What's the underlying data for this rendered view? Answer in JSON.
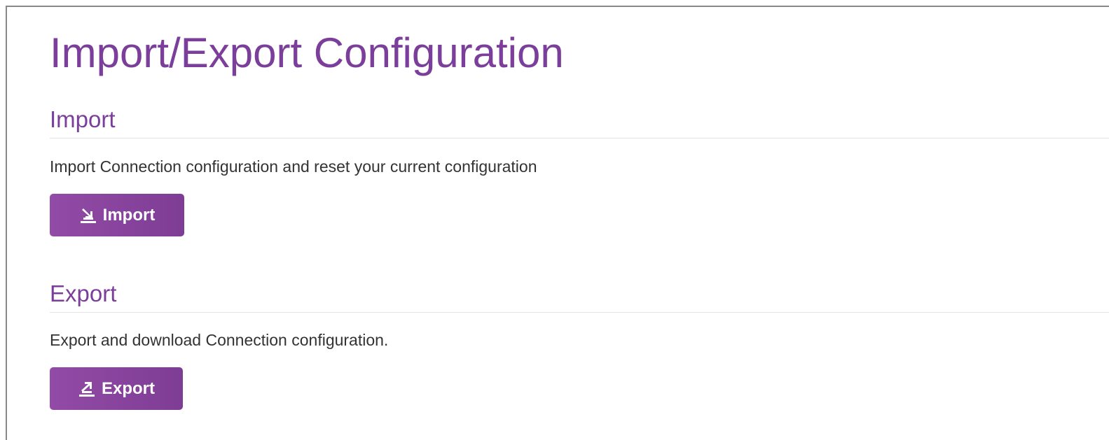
{
  "page": {
    "title": "Import/Export Configuration"
  },
  "import_section": {
    "heading": "Import",
    "description": "Import Connection configuration and reset your current configuration",
    "button_label": "Import",
    "button_icon": "import-icon"
  },
  "export_section": {
    "heading": "Export",
    "description": "Export and download Connection configuration.",
    "button_label": "Export",
    "button_icon": "export-icon"
  },
  "colors": {
    "accent": "#7b3f9b",
    "button": "#8a46a0",
    "text": "#333333",
    "border": "#888888"
  }
}
